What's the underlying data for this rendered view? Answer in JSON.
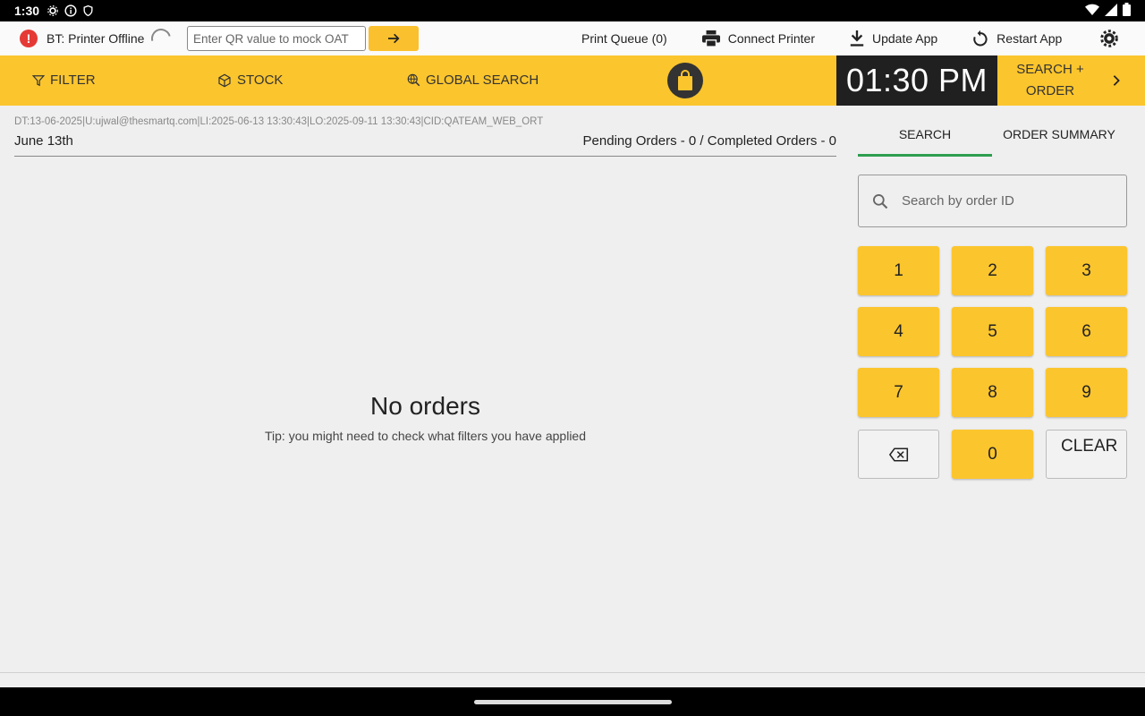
{
  "status_bar": {
    "time": "1:30"
  },
  "topbar": {
    "printer_status": "BT: Printer Offline",
    "qr_placeholder": "Enter QR value to mock OAT",
    "actions": {
      "print_queue": "Print Queue (0)",
      "connect_printer": "Connect Printer",
      "update_app": "Update App",
      "restart_app": "Restart App"
    }
  },
  "toolbar": {
    "filter": "FILTER",
    "stock": "STOCK",
    "global_search": "GLOBAL SEARCH",
    "clock": "01:30 PM",
    "search_order": "SEARCH + ORDER"
  },
  "main": {
    "meta": "DT:13-06-2025|U:ujwal@thesmartq.com|LI:2025-06-13 13:30:43|LO:2025-09-11 13:30:43|CID:QATEAM_WEB_ORT",
    "date": "June 13th",
    "counts": "Pending Orders - 0 / Completed Orders - 0",
    "empty_title": "No orders",
    "empty_tip": "Tip: you might need to check what filters you have applied"
  },
  "panel": {
    "tabs": [
      "SEARCH",
      "ORDER SUMMARY"
    ],
    "active_tab": "SEARCH",
    "search_placeholder": "Search by order ID",
    "keys": [
      "1",
      "2",
      "3",
      "4",
      "5",
      "6",
      "7",
      "8",
      "9",
      "0"
    ],
    "clear": "CLEAR"
  },
  "colors": {
    "accent": "#fbc52d",
    "tab_indicator": "#2e9e4f",
    "error": "#e53935"
  }
}
